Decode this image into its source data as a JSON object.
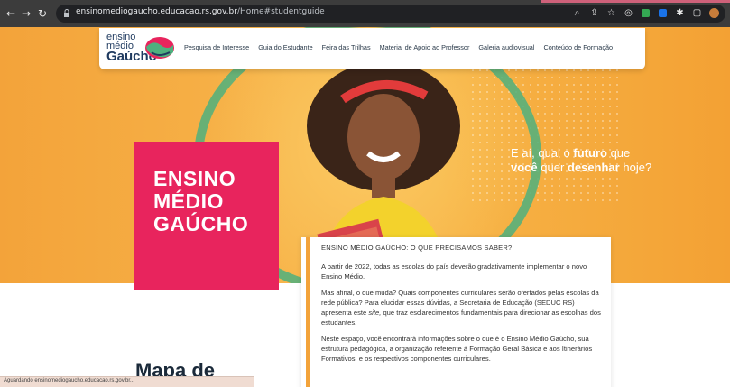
{
  "browser": {
    "url_host": "ensinomediogaucho.educacao.rs.gov.br",
    "url_path": "/Home#studentguide",
    "status_text": "Aguardando ensinomediogaucho.educacao.rs.gov.br..."
  },
  "logo": {
    "line1": "ensino",
    "line2": "médio",
    "line3": "Gaúcho"
  },
  "nav": {
    "items": [
      "Pesquisa de Interesse",
      "Guia do Estudante",
      "Feira das Trilhas",
      "Material de Apoio ao Professor",
      "Galeria audiovisual",
      "Conteúdo de Formação"
    ]
  },
  "hero": {
    "title_line1": "ENSINO",
    "title_line2": "MÉDIO",
    "title_line3": "GAÚCHO",
    "tagline_a": "E aí, qual o",
    "tagline_b": "futuro",
    "tagline_c": "que",
    "tagline_d": "você",
    "tagline_e": "quer",
    "tagline_f": "desenhar",
    "tagline_g": "hoje?"
  },
  "content": {
    "heading": "ENSINO MÉDIO GAÚCHO: O QUE PRECISAMOS SABER?",
    "p1": "A partir de 2022, todas as escolas do país deverão gradativamente implementar o novo Ensino Médio.",
    "p2a": "Mas afinal, o que muda? Quais componentes curriculares serão ofertados pelas escolas da rede pública? Para elucidar essas dúvidas, a Secretaria de Educação (SEDUC RS) apresenta este",
    "p2b": "site,",
    "p2c": "que traz esclarecimentos fundamentais para direcionar as escolhas dos estudantes.",
    "p3": "Neste espaço, você encontrará informações sobre o que é o Ensino Médio Gaúcho, sua estrutura pedagógica, a organização referente à Formação Geral Básica e aos Itinerários Formativos, e os respectivos componentes curriculares."
  },
  "section": {
    "map_title": "Mapa de"
  },
  "colors": {
    "brand_pink": "#e8245d",
    "hero_orange": "#f3a33a",
    "accent_green": "#4fb07e"
  }
}
